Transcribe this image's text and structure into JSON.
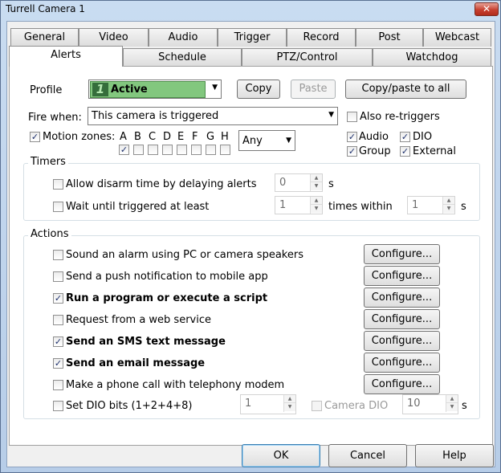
{
  "window": {
    "title": "Turrell Camera 1",
    "close_glyph": "✕"
  },
  "tabs_row1": [
    "General",
    "Video",
    "Audio",
    "Trigger",
    "Record",
    "Post",
    "Webcast"
  ],
  "tabs_row2": [
    "Alerts",
    "Schedule",
    "PTZ/Control",
    "Watchdog"
  ],
  "active_tab": "Alerts",
  "profile": {
    "label": "Profile",
    "number": "1",
    "name": "Active",
    "color": "#82c77e",
    "copy_label": "Copy",
    "paste_label": "Paste",
    "copy_all_label": "Copy/paste to all"
  },
  "fire_when": {
    "label": "Fire when:",
    "value": "This camera is triggered",
    "also_retriggers_label": "Also re-triggers"
  },
  "motion": {
    "label": "Motion zones:",
    "zones": [
      {
        "letter": "A",
        "checked": true
      },
      {
        "letter": "B",
        "checked": false
      },
      {
        "letter": "C",
        "checked": false
      },
      {
        "letter": "D",
        "checked": false
      },
      {
        "letter": "E",
        "checked": false
      },
      {
        "letter": "F",
        "checked": false
      },
      {
        "letter": "G",
        "checked": false
      },
      {
        "letter": "H",
        "checked": false
      }
    ],
    "mode": "Any"
  },
  "sources": {
    "audio": "Audio",
    "dio": "DIO",
    "group": "Group",
    "external": "External"
  },
  "timers": {
    "title": "Timers",
    "disarm_label": "Allow disarm time by delaying alerts",
    "disarm_value": "0",
    "disarm_unit": "s",
    "wait_label": "Wait until triggered at least",
    "wait_value": "1",
    "times_within_label": "times within",
    "within_value": "1",
    "within_unit": "s"
  },
  "actions": {
    "title": "Actions",
    "configure_label": "Configure...",
    "items": [
      {
        "label": "Sound an alarm using PC or camera speakers",
        "checked": false,
        "bold": false
      },
      {
        "label": "Send a push notification to mobile app",
        "checked": false,
        "bold": false
      },
      {
        "label": "Run a program or execute a script",
        "checked": true,
        "bold": true
      },
      {
        "label": "Request from a web service",
        "checked": false,
        "bold": false
      },
      {
        "label": "Send an SMS text message",
        "checked": true,
        "bold": true
      },
      {
        "label": "Send an email message",
        "checked": true,
        "bold": true
      },
      {
        "label": "Make a phone call with telephony modem",
        "checked": false,
        "bold": false
      }
    ],
    "dio_label": "Set DIO bits (1+2+4+8)",
    "dio_value": "1",
    "camera_dio_label": "Camera DIO",
    "camera_dio_value": "10",
    "dio_unit": "s"
  },
  "footer": {
    "ok": "OK",
    "cancel": "Cancel",
    "help": "Help"
  },
  "check_glyph": "✓"
}
